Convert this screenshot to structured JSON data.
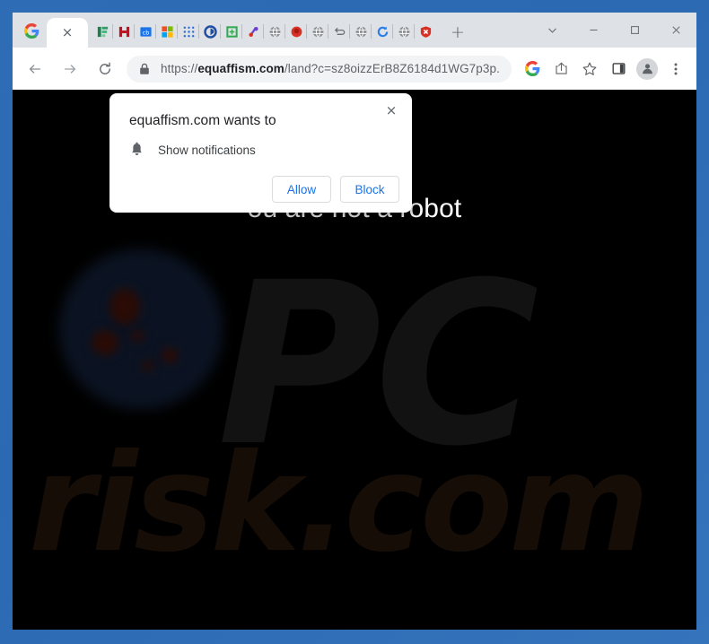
{
  "window": {
    "controls": {
      "tab_search": "tab-search",
      "minimize": "–",
      "maximize": "□",
      "close": "×"
    }
  },
  "tabstrip": {
    "pinned_tab_icon": "google-icon",
    "active_tab_close": "×",
    "new_tab_label": "+",
    "extensions": [
      {
        "name": "extension-green-bars",
        "glyph": "☰",
        "color": "#1d7f4e"
      },
      {
        "name": "extension-h-red",
        "glyph": "H",
        "color": "#c1121f"
      },
      {
        "name": "extension-cb-blue",
        "glyph": "cb",
        "color": "#1a73e8"
      },
      {
        "name": "extension-microsoft-squares",
        "glyph": "",
        "color": "#f25022"
      },
      {
        "name": "extension-blue-dots-grid",
        "glyph": "",
        "color": "#2b6cd4"
      },
      {
        "name": "extension-shield-circle",
        "glyph": "",
        "color": "#1e4fa3"
      },
      {
        "name": "extension-green-crop",
        "glyph": "",
        "color": "#34a853"
      },
      {
        "name": "extension-purple-link",
        "glyph": "",
        "color": "#6a3fd1"
      },
      {
        "name": "extension-globe-gray-1",
        "glyph": "",
        "color": "#5f6368"
      },
      {
        "name": "extension-red-record",
        "glyph": "",
        "color": "#d93025"
      },
      {
        "name": "extension-globe-gray-2",
        "glyph": "",
        "color": "#5f6368"
      },
      {
        "name": "extension-swap-arrows",
        "glyph": "",
        "color": "#5f6368"
      },
      {
        "name": "extension-globe-gray-3",
        "glyph": "",
        "color": "#5f6368"
      },
      {
        "name": "extension-refresh-blue",
        "glyph": "",
        "color": "#2b7de9"
      },
      {
        "name": "extension-globe-gray-4",
        "glyph": "",
        "color": "#5f6368"
      },
      {
        "name": "extension-shield-red-x",
        "glyph": "",
        "color": "#d93025"
      }
    ]
  },
  "toolbar": {
    "back": "back-arrow",
    "forward": "forward-arrow",
    "reload": "reload",
    "lock": "lock-icon",
    "url_scheme": "https://",
    "url_domain": "equaffism.com",
    "url_path": "/land?c=sz8oizzErB8Z6184d1WG7p3p...",
    "url_full": "https://equaffism.com/land?c=sz8oizzErB8Z6184d1WG7p3p...",
    "search_icon": "google-search-icon",
    "share_icon": "share-icon",
    "bookmark_icon": "star-icon",
    "sidepanel_icon": "side-panel-icon",
    "profile_icon": "profile-avatar",
    "menu_icon": "three-dot-menu"
  },
  "page": {
    "heading_visible_text": "ou are not a robot",
    "background_color": "#000000",
    "text_color": "#ffffff",
    "watermark_pc": "PC",
    "watermark_risk": "risk.com"
  },
  "dialog": {
    "title": "equaffism.com wants to",
    "permission_icon": "bell-icon",
    "permission_label": "Show notifications",
    "close_label": "×",
    "allow_label": "Allow",
    "block_label": "Block",
    "accent_color": "#1a73e8"
  }
}
